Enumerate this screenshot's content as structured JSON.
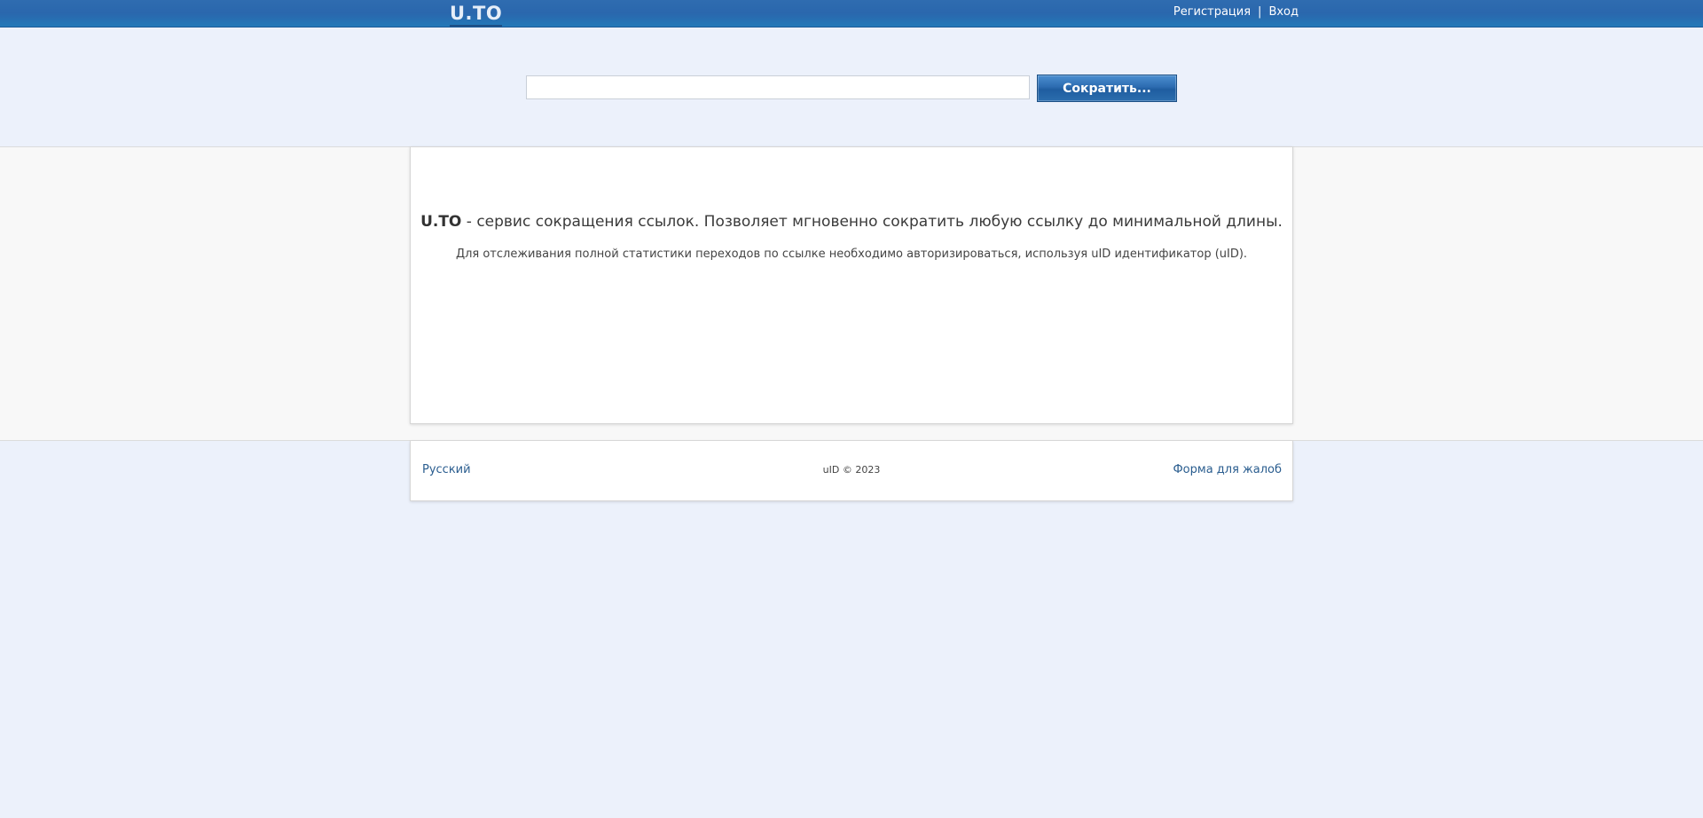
{
  "header": {
    "logo": "U.TO",
    "register_label": "Регистрация",
    "separator": "|",
    "login_label": "Вход"
  },
  "shortener": {
    "input_value": "",
    "button_label": "Сократить..."
  },
  "main": {
    "intro_brand": "U.TO",
    "intro_text": " - сервис сокращения ссылок. Позволяет мгновенно сократить любую ссылку до минимальной длины.",
    "note": "Для отслеживания полной статистики переходов по ссылке необходимо авторизироваться, используя uID идентификатор (uID)."
  },
  "footer": {
    "language_label": "Русский",
    "copyright": "uID © 2023",
    "complaint_label": "Форма для жалоб"
  }
}
